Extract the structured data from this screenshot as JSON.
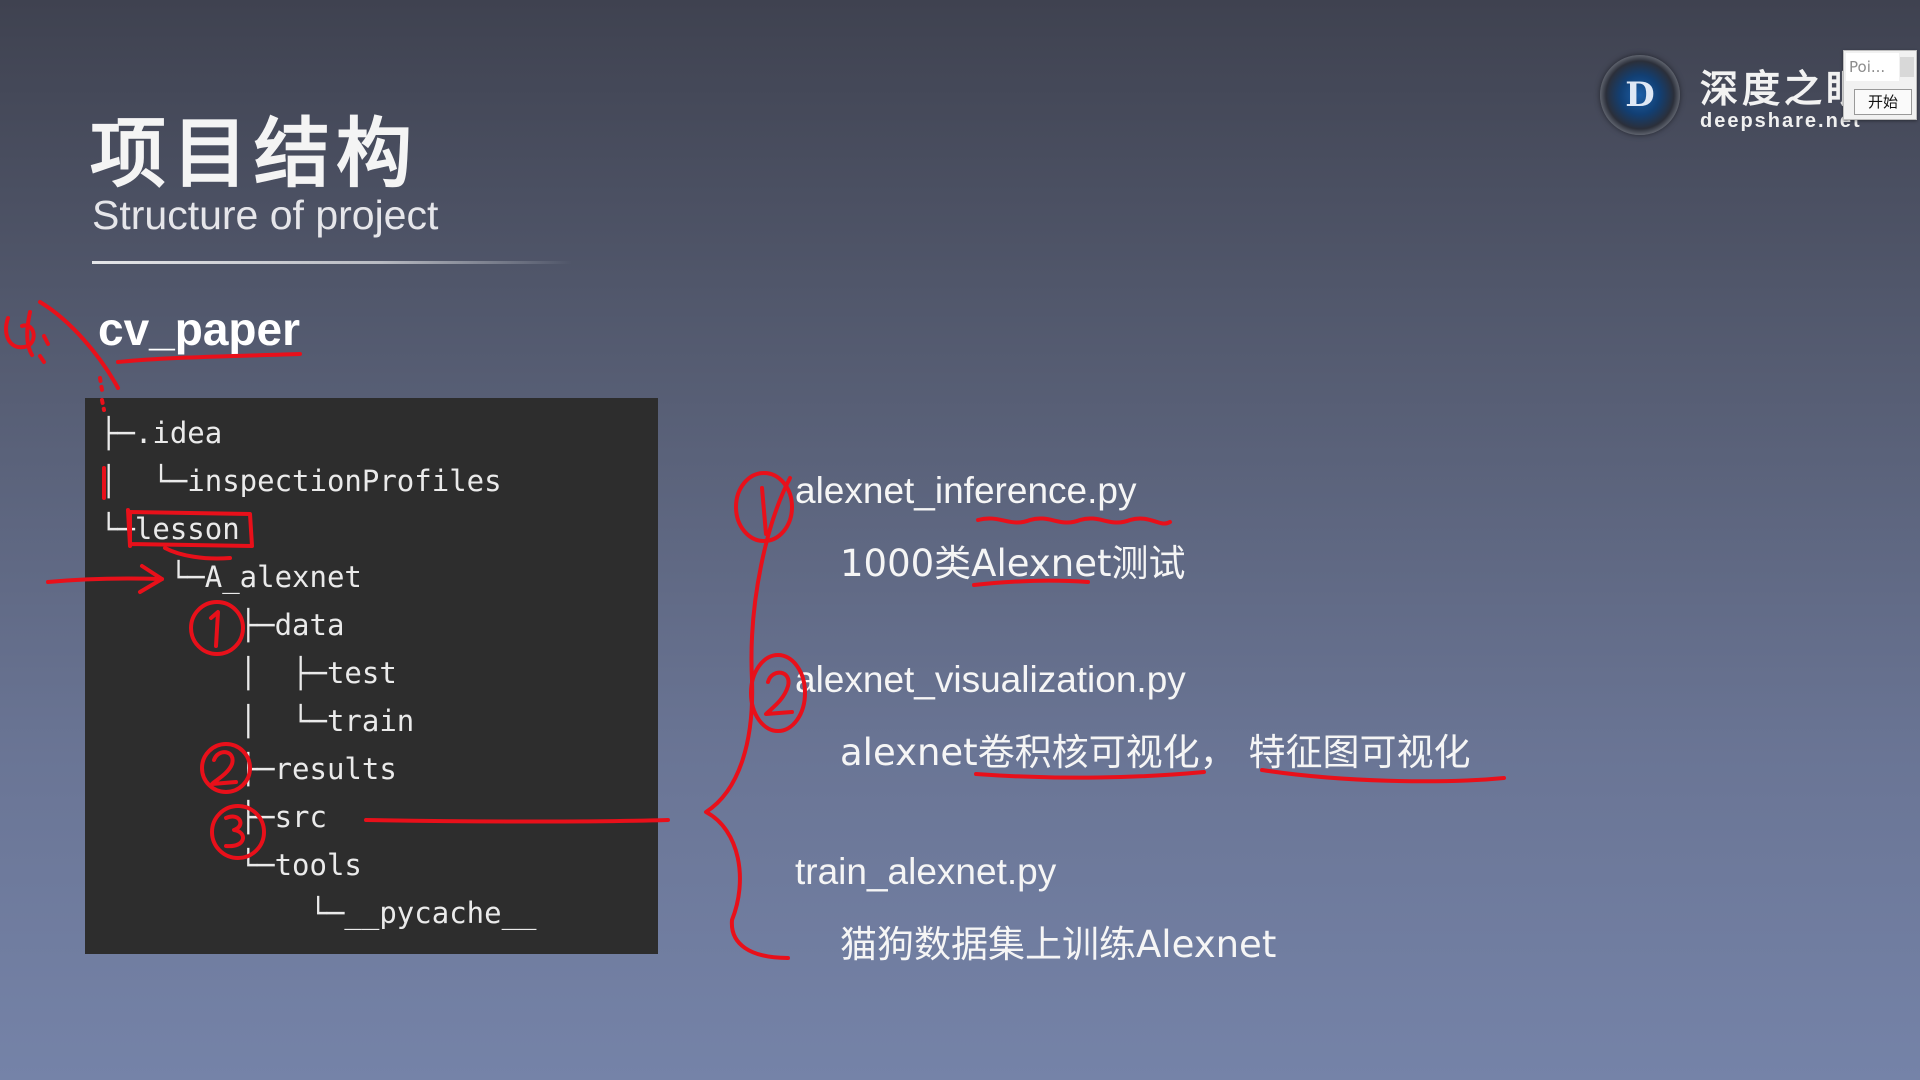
{
  "slide": {
    "title": "项目结构",
    "subtitle": "Structure of project"
  },
  "logo": {
    "letter": "D",
    "name_cn": "深度之眼",
    "name_en": "deepshare.net"
  },
  "popup": {
    "field": "Poi...",
    "button": "开始"
  },
  "project": {
    "root": "cv_paper",
    "tree": [
      "├─.idea",
      "│  └─inspectionProfiles",
      "└─lesson",
      "    └─A_alexnet",
      "        ├─data",
      "        │  ├─test",
      "        │  └─train",
      "        ├─results",
      "        ├─src",
      "        └─tools",
      "            └─__pycache__"
    ]
  },
  "files": [
    {
      "name": "alexnet_inference.py",
      "desc": "1000类Alexnet测试"
    },
    {
      "name": "alexnet_visualization.py",
      "desc": "alexnet卷积核可视化， 特征图可视化"
    },
    {
      "name": "train_alexnet.py",
      "desc": "猫狗数据集上训练Alexnet"
    }
  ],
  "colors": {
    "annotation": "#e8101a",
    "tree_background": "#2d2d2d"
  }
}
